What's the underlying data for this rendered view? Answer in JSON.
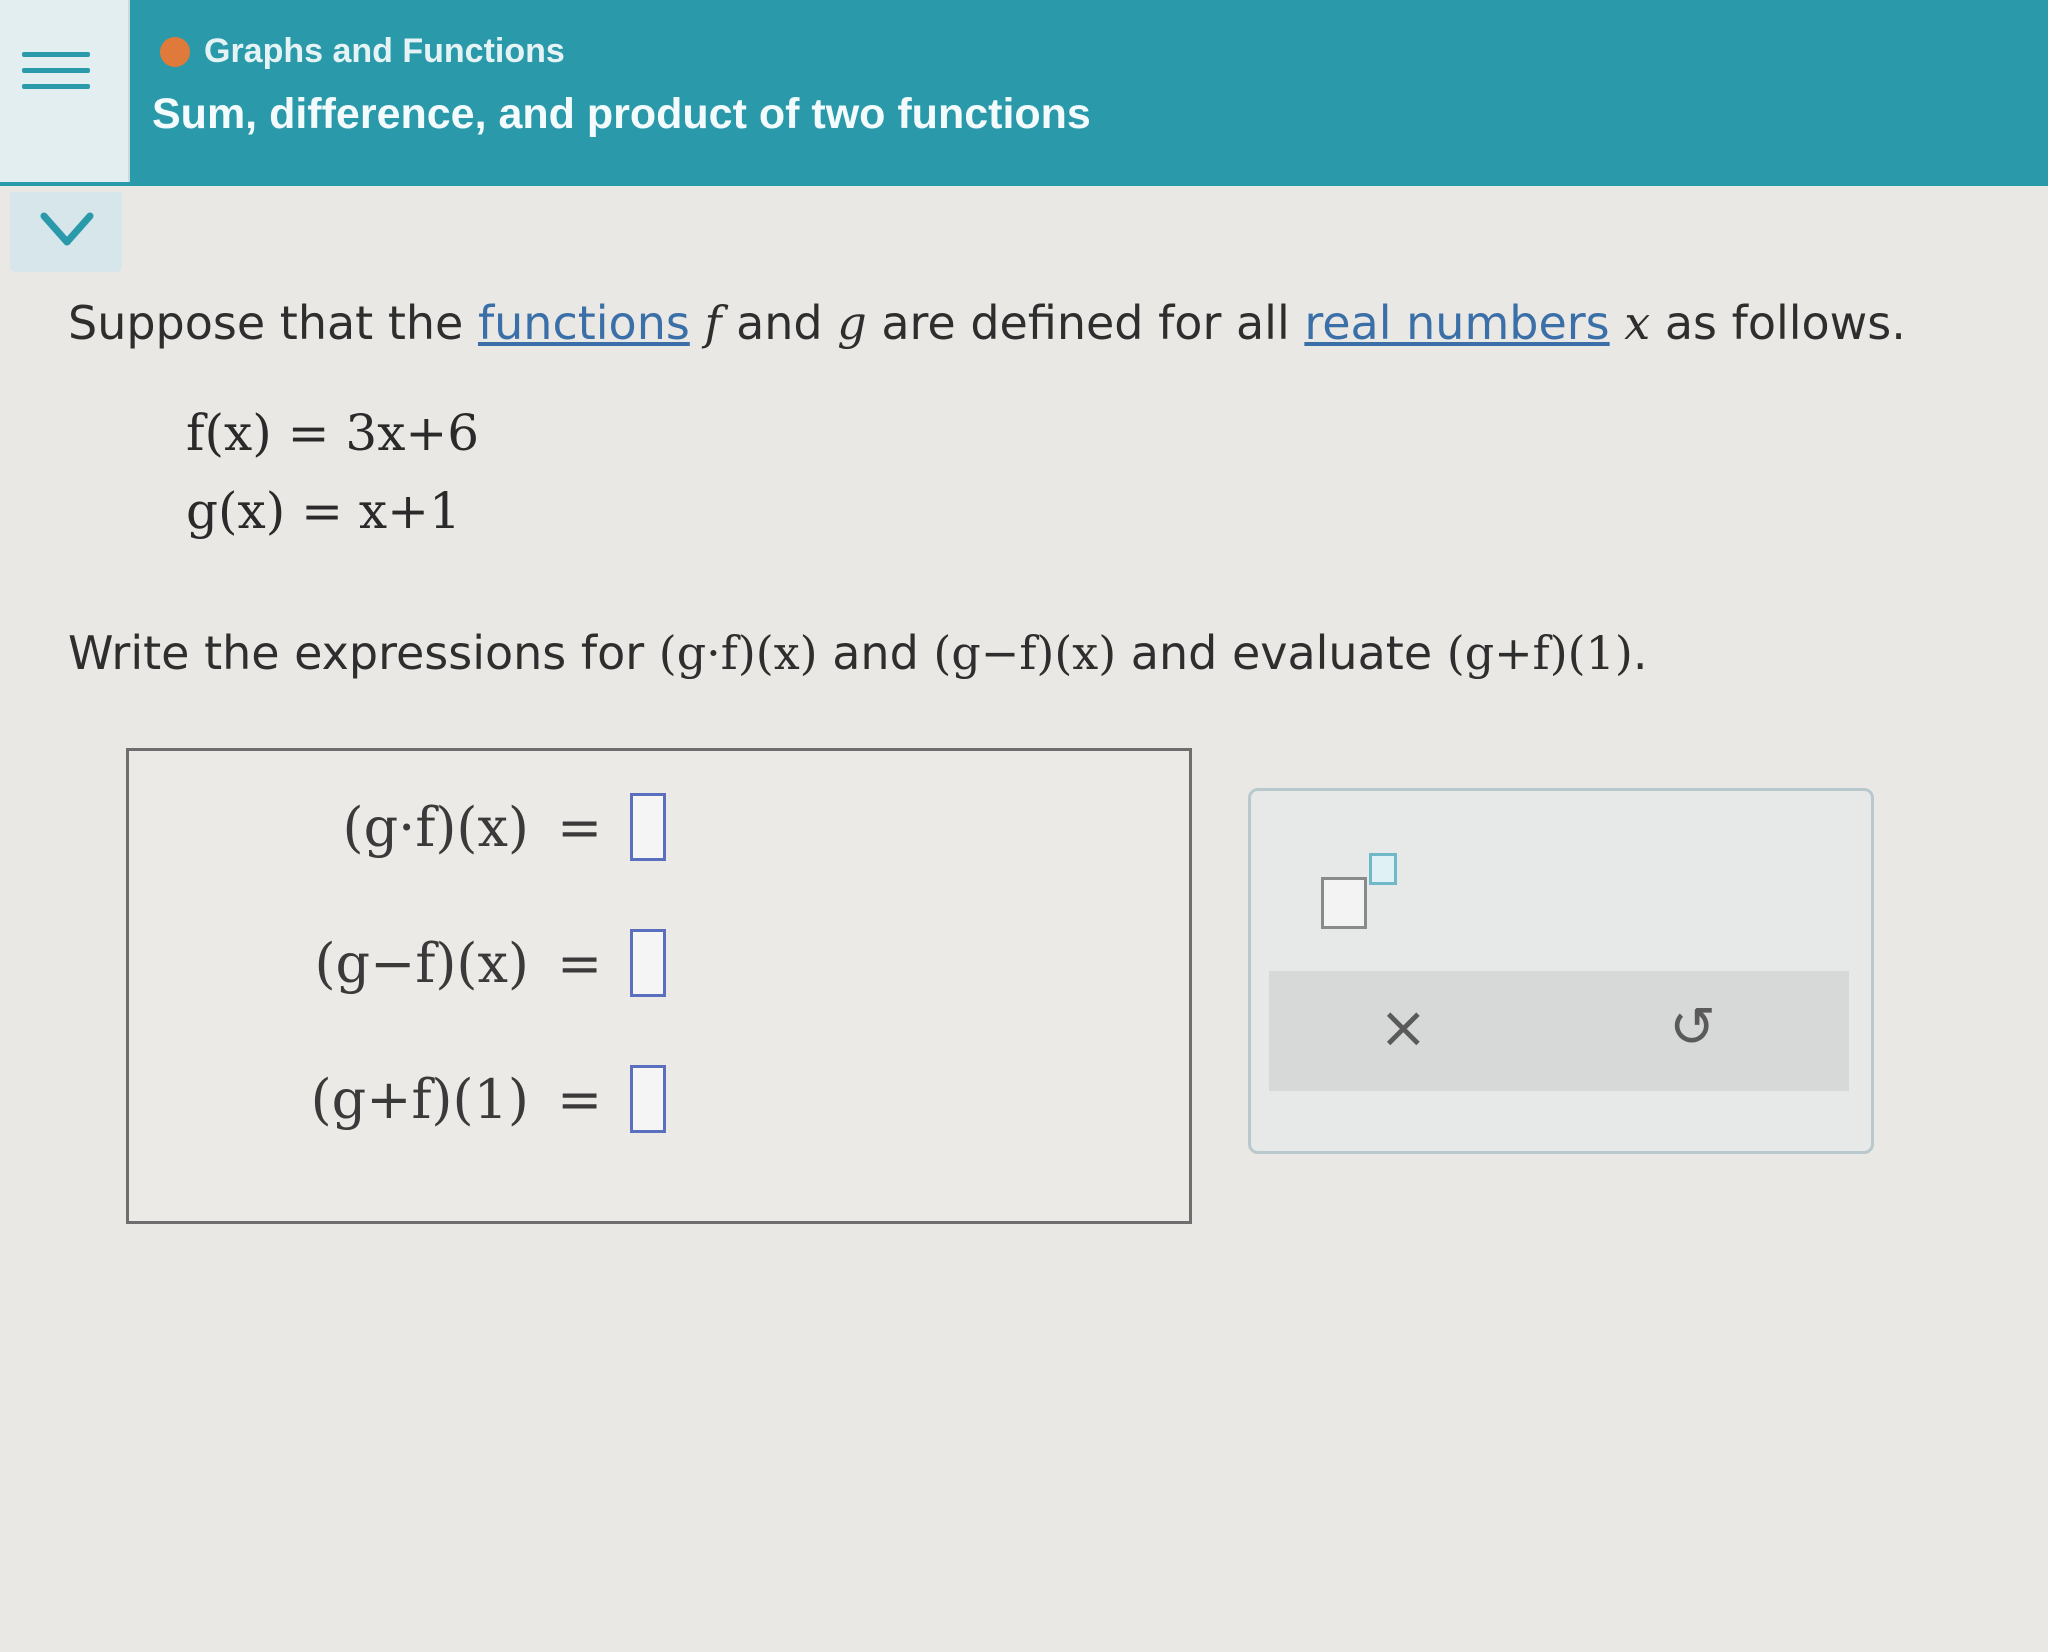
{
  "header": {
    "breadcrumb": "Graphs and Functions",
    "title": "Sum, difference, and product of two functions",
    "accent_color": "#2a9aab",
    "status_dot_color": "#e07a3a"
  },
  "problem": {
    "intro_1": "Suppose that the ",
    "link_functions": "functions",
    "intro_f": "f",
    "intro_and": " and ",
    "intro_g": "g",
    "intro_2": " are defined for all ",
    "link_real_numbers": "real numbers",
    "intro_x": "x",
    "intro_3": " as follows.",
    "f_def": "f(x) = 3x+6",
    "g_def": "g(x) = x+1",
    "q_1": "Write the expressions for ",
    "q_expr1": "(g·f)(x)",
    "q_and": " and ",
    "q_expr2": "(g−f)(x)",
    "q_2": " and evaluate ",
    "q_expr3": "(g+f)(1)",
    "q_end": "."
  },
  "answers": [
    {
      "label": "(g·f)(x)",
      "eq": "=",
      "value": ""
    },
    {
      "label": "(g−f)(x)",
      "eq": "=",
      "value": ""
    },
    {
      "label": "(g+f)(1)",
      "eq": "=",
      "value": ""
    }
  ],
  "toolbox": {
    "exponent_icon": "exponent-template-icon",
    "clear_label": "×",
    "undo_label": "↺"
  }
}
